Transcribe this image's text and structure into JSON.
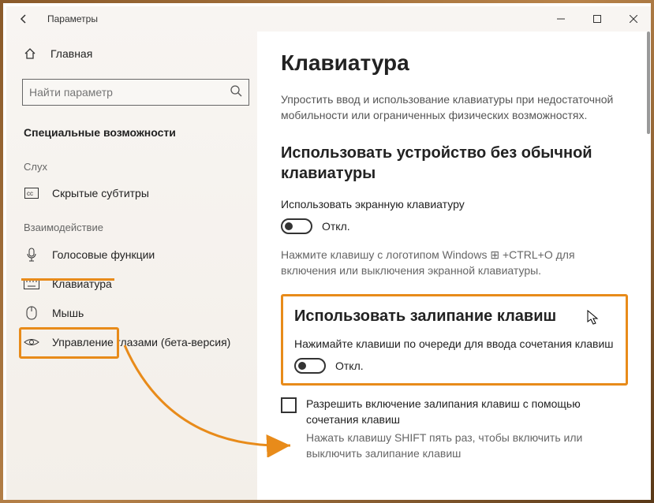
{
  "window": {
    "title": "Параметры"
  },
  "sidebar": {
    "home": "Главная",
    "search_placeholder": "Найти параметр",
    "section": "Специальные возможности",
    "groups": [
      {
        "label": "Слух",
        "items": [
          {
            "icon": "cc",
            "label": "Скрытые субтитры"
          }
        ]
      },
      {
        "label": "Взаимодействие",
        "items": [
          {
            "icon": "mic",
            "label": "Голосовые функции"
          },
          {
            "icon": "kbd",
            "label": "Клавиатура",
            "active": true
          },
          {
            "icon": "mouse",
            "label": "Мышь"
          },
          {
            "icon": "eye",
            "label": "Управление глазами (бета-версия)"
          }
        ]
      }
    ]
  },
  "main": {
    "heading": "Клавиатура",
    "intro": "Упростить ввод и использование клавиатуры при недостаточной мобильности или ограниченных физических возможностях.",
    "osk_h": "Использовать устройство без обычной клавиатуры",
    "osk_label": "Использовать экранную клавиатуру",
    "osk_state": "Откл.",
    "osk_hint": "Нажмите клавишу с логотипом Windows ⊞ +CTRL+O для включения или выключения экранной клавиатуры.",
    "sticky_h": "Использовать залипание клавиш",
    "sticky_label": "Нажимайте клавиши по очереди для ввода сочетания клавиш",
    "sticky_state": "Откл.",
    "check_label": "Разрешить включение залипания клавиш с помощью сочетания клавиш",
    "check_hint": "Нажать клавишу SHIFT пять раз, чтобы включить или выключить залипание клавиш"
  }
}
